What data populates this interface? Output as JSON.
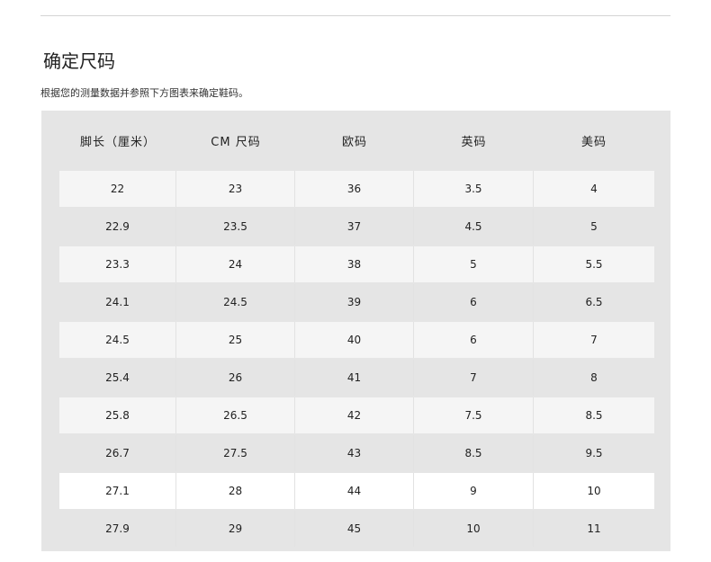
{
  "header": {
    "title": "确定尺码",
    "subtitle": "根据您的测量数据并参照下方图表来确定鞋码。"
  },
  "table": {
    "columns": [
      "脚长（厘米）",
      "CM 尺码",
      "欧码",
      "英码",
      "美码"
    ],
    "rows": [
      [
        "22",
        "23",
        "36",
        "3.5",
        "4"
      ],
      [
        "22.9",
        "23.5",
        "37",
        "4.5",
        "5"
      ],
      [
        "23.3",
        "24",
        "38",
        "5",
        "5.5"
      ],
      [
        "24.1",
        "24.5",
        "39",
        "6",
        "6.5"
      ],
      [
        "24.5",
        "25",
        "40",
        "6",
        "7"
      ],
      [
        "25.4",
        "26",
        "41",
        "7",
        "8"
      ],
      [
        "25.8",
        "26.5",
        "42",
        "7.5",
        "8.5"
      ],
      [
        "26.7",
        "27.5",
        "43",
        "8.5",
        "9.5"
      ],
      [
        "27.1",
        "28",
        "44",
        "9",
        "10"
      ],
      [
        "27.9",
        "29",
        "45",
        "10",
        "11"
      ]
    ],
    "row_styles": [
      "odd",
      "even",
      "odd",
      "even",
      "odd",
      "even",
      "odd",
      "even",
      "white",
      "even"
    ]
  },
  "colors": {
    "panel_background": "#e5e5e5",
    "alt_row_background": "#f5f5f5",
    "text": "#222222"
  }
}
